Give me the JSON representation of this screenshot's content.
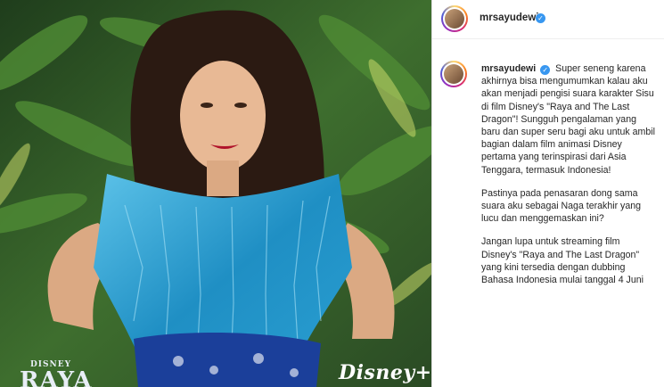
{
  "post": {
    "username": "mrsayudewi",
    "verified": true,
    "caption_paragraphs": [
      "Super seneng karena akhirnya bisa mengumumkan kalau aku akan menjadi pengisi suara karakter Sisu di film Disney's \"Raya and The Last Dragon\"! Sungguh pengalaman yang baru dan super seru bagi aku untuk ambil bagian dalam film animasi Disney pertama yang terinspirasi dari Asia Tenggara, termasuk Indonesia!",
      "Pastinya pada penasaran dong sama suara aku sebagai Naga terakhir yang lucu dan menggemaskan ini?",
      "Jangan lupa untuk streaming film Disney's \"Raya and The Last Dragon\" yang kini tersedia dengan dubbing Bahasa Indonesia mulai tanggal 4 Juni"
    ]
  },
  "image": {
    "logo_left_small": "DISNEY",
    "logo_left_big": "RAYA",
    "logo_right": "Disney+"
  },
  "colors": {
    "verified_blue": "#3897f0",
    "text": "#262626",
    "dress_blue": "#2aa3d6",
    "foliage": "#2f5a2a"
  }
}
